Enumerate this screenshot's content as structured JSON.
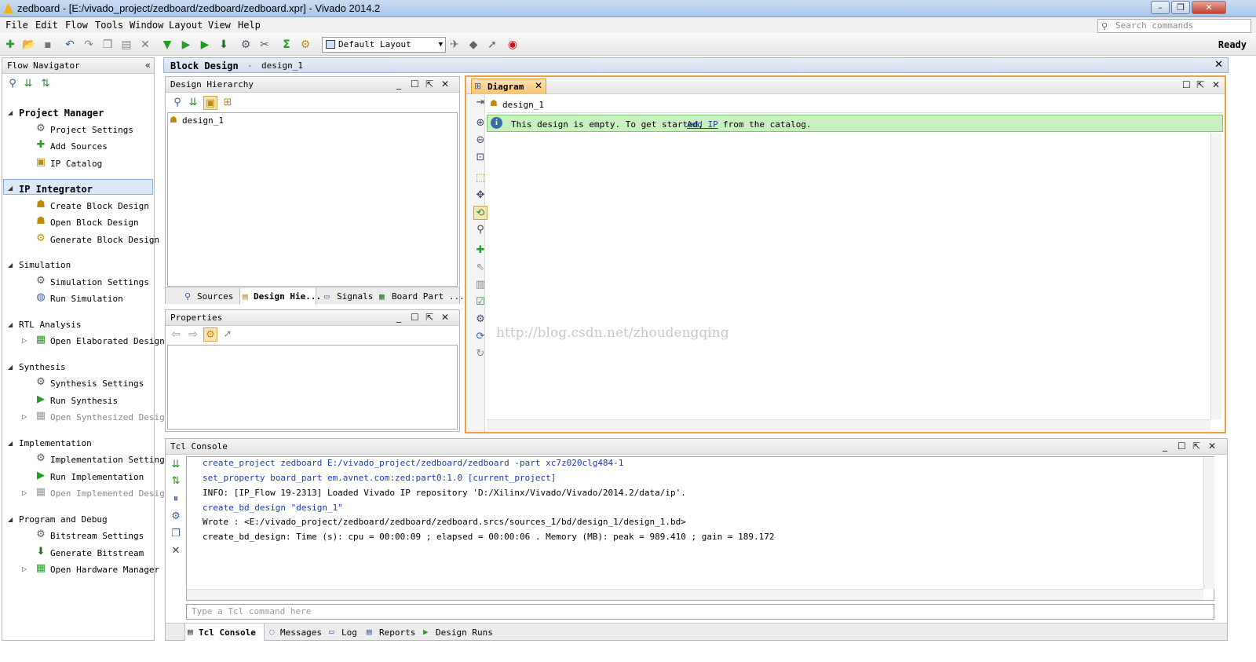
{
  "window": {
    "title": "zedboard - [E:/vivado_project/zedboard/zedboard/zedboard.xpr] - Vivado 2014.2"
  },
  "menu": [
    "File",
    "Edit",
    "Flow",
    "Tools",
    "Window",
    "Layout",
    "View",
    "Help"
  ],
  "search": {
    "placeholder": "Search commands"
  },
  "toolbar": {
    "layout": "Default Layout",
    "status": "Ready"
  },
  "flow_navigator": {
    "title": "Flow Navigator",
    "sections": [
      {
        "label": "Project Manager",
        "items": [
          "Project Settings",
          "Add Sources",
          "IP Catalog"
        ]
      },
      {
        "label": "IP Integrator",
        "items": [
          "Create Block Design",
          "Open Block Design",
          "Generate Block Design"
        ]
      },
      {
        "label": "Simulation",
        "items": [
          "Simulation Settings",
          "Run Simulation"
        ]
      },
      {
        "label": "RTL Analysis",
        "items": [
          "Open Elaborated Design"
        ]
      },
      {
        "label": "Synthesis",
        "items": [
          "Synthesis Settings",
          "Run Synthesis",
          "Open Synthesized Design"
        ]
      },
      {
        "label": "Implementation",
        "items": [
          "Implementation Settings",
          "Run Implementation",
          "Open Implemented Design"
        ]
      },
      {
        "label": "Program and Debug",
        "items": [
          "Bitstream Settings",
          "Generate Bitstream",
          "Open Hardware Manager"
        ]
      }
    ]
  },
  "block_design": {
    "title": "Block Design",
    "sep": "-",
    "name": "design_1"
  },
  "hierarchy": {
    "title": "Design Hierarchy",
    "root": "design_1",
    "tabs": [
      "Sources",
      "Design Hie...",
      "Signals",
      "Board Part ..."
    ]
  },
  "properties": {
    "title": "Properties"
  },
  "diagram": {
    "tab": "Diagram",
    "root": "design_1",
    "info_prefix": "This design is empty. To get started,",
    "info_link": "Add IP",
    "info_suffix": "from the catalog.",
    "watermark": "http://blog.csdn.net/zhoudengqing"
  },
  "console": {
    "title": "Tcl Console",
    "lines": [
      {
        "text": "create_project zedboard E:/vivado_project/zedboard/zedboard -part xc7z020clg484-1",
        "cmd": true
      },
      {
        "text": "set_property board_part em.avnet.com:zed:part0:1.0 [current_project]",
        "cmd": true
      },
      {
        "text": "INFO: [IP_Flow 19-2313] Loaded Vivado IP repository 'D:/Xilinx/Vivado/Vivado/2014.2/data/ip'.",
        "cmd": false
      },
      {
        "text": "create_bd_design \"design_1\"",
        "cmd": true
      },
      {
        "text": "Wrote  : <E:/vivado_project/zedboard/zedboard/zedboard.srcs/sources_1/bd/design_1/design_1.bd>",
        "cmd": false
      },
      {
        "text": "create_bd_design: Time (s): cpu = 00:00:09 ; elapsed = 00:00:06 . Memory (MB): peak = 989.410 ; gain = 189.172",
        "cmd": false
      }
    ],
    "input_placeholder": "Type a Tcl command here",
    "tabs": [
      "Tcl Console",
      "Messages",
      "Log",
      "Reports",
      "Design Runs"
    ]
  }
}
